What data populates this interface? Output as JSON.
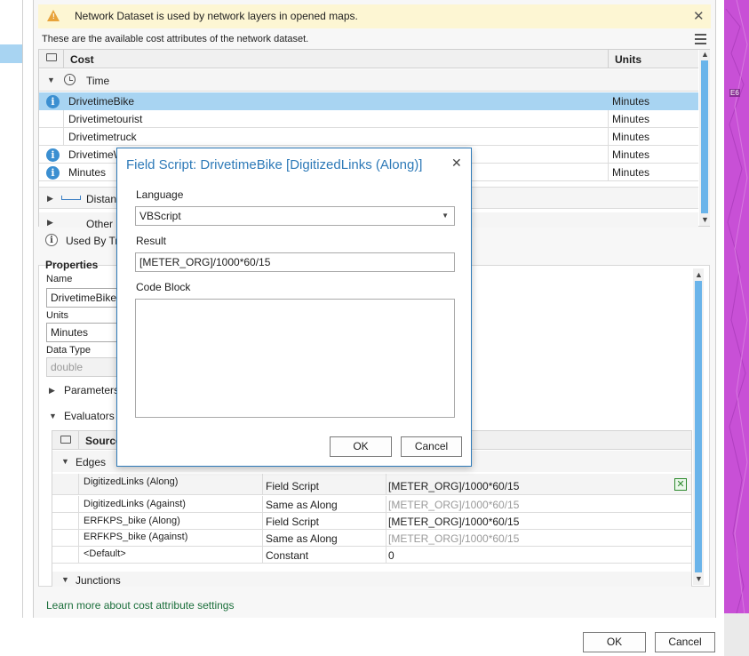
{
  "banner": {
    "message": "Network Dataset is used by network layers in opened maps."
  },
  "panel": {
    "description": "These are the available cost attributes of the network dataset.",
    "table": {
      "col_cost": "Cost",
      "col_units": "Units",
      "group_time": "Time",
      "rows": [
        {
          "name": "DrivetimeBike",
          "units": "Minutes"
        },
        {
          "name": "Drivetimetourist",
          "units": "Minutes"
        },
        {
          "name": "Drivetimetruck",
          "units": "Minutes"
        },
        {
          "name": "DrivetimeW",
          "units": "Minutes"
        },
        {
          "name": "Minutes",
          "units": "Minutes"
        }
      ],
      "group_distance": "Distance",
      "group_other": "Other"
    },
    "used_by": "Used By Tra"
  },
  "properties": {
    "title": "Properties",
    "name_label": "Name",
    "name_value": "DrivetimeBike",
    "units_label": "Units",
    "units_value": "Minutes",
    "datatype_label": "Data Type",
    "datatype_value": "double",
    "parameters_label": "Parameters",
    "evaluators_label": "Evaluators"
  },
  "evaluators": {
    "col_source": "Source",
    "edges_label": "Edges",
    "rows": [
      {
        "source": "DigitizedLinks (Along)",
        "type": "Field Script",
        "value": "[METER_ORG]/1000*60/15",
        "muted": false
      },
      {
        "source": "DigitizedLinks (Against)",
        "type": "Same as Along",
        "value": "[METER_ORG]/1000*60/15",
        "muted": true
      },
      {
        "source": "ERFKPS_bike (Along)",
        "type": "Field Script",
        "value": "[METER_ORG]/1000*60/15",
        "muted": false
      },
      {
        "source": "ERFKPS_bike (Against)",
        "type": "Same as Along",
        "value": "[METER_ORG]/1000*60/15",
        "muted": true
      },
      {
        "source": "<Default>",
        "type": "Constant",
        "value": "0",
        "muted": false
      }
    ],
    "junctions_label": "Junctions"
  },
  "learn_more": "Learn more about cost attribute settings",
  "footer": {
    "ok": "OK",
    "cancel": "Cancel"
  },
  "dialog": {
    "title": "Field Script: DrivetimeBike [DigitizedLinks (Along)]",
    "language_label": "Language",
    "language_value": "VBScript",
    "result_label": "Result",
    "result_value": "[METER_ORG]/1000*60/15",
    "codeblock_label": "Code Block",
    "codeblock_value": "",
    "ok": "OK",
    "cancel": "Cancel"
  },
  "map": {
    "road_label": "E6"
  },
  "colors": {
    "accent": "#2e7ab8",
    "selected_row": "#a8d4f2",
    "banner_bg": "#fdf6d3",
    "map_magenta": "#c850d6"
  }
}
